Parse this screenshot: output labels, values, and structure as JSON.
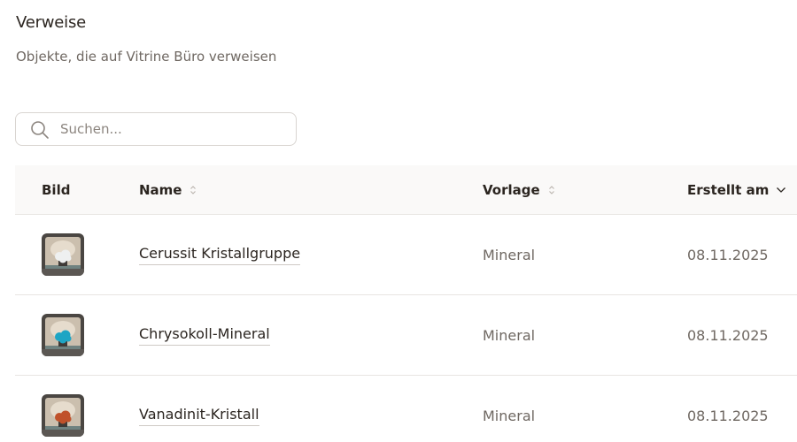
{
  "section": {
    "title": "Verweise",
    "subtitle": "Objekte, die auf Vitrine Büro verweisen"
  },
  "search": {
    "placeholder": "Suchen...",
    "value": "",
    "icon": "search-icon"
  },
  "table": {
    "columns": [
      {
        "label": "Bild",
        "sort": "none"
      },
      {
        "label": "Name",
        "sort": "sortable"
      },
      {
        "label": "Vorlage",
        "sort": "sortable"
      },
      {
        "label": "Erstellt am",
        "sort": "descending"
      }
    ],
    "rows": [
      {
        "name": "Cerussit Kristallgruppe",
        "template": "Mineral",
        "created": "08.11.2025",
        "mineral_color": "#eef0f0"
      },
      {
        "name": "Chrysokoll-Mineral",
        "template": "Mineral",
        "created": "08.11.2025",
        "mineral_color": "#1ea5c4"
      },
      {
        "name": "Vanadinit-Kristall",
        "template": "Mineral",
        "created": "08.11.2025",
        "mineral_color": "#c0512a"
      }
    ]
  },
  "colors": {
    "text_primary": "#2b2520",
    "text_secondary": "#6f6862",
    "border": "#e8e5e2",
    "header_bg": "#faf9f8"
  }
}
